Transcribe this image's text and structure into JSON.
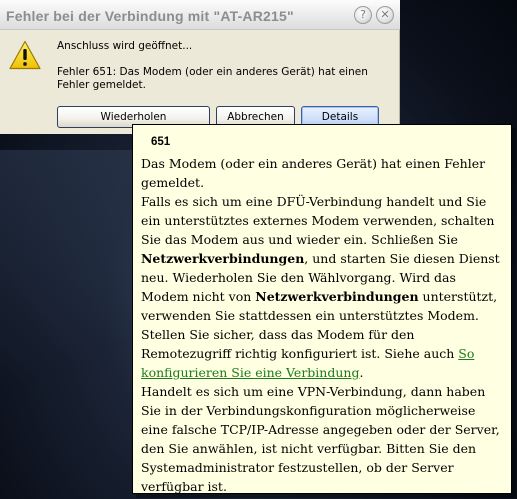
{
  "dialog": {
    "title": "Fehler bei der Verbindung mit \"AT-AR215\"",
    "help_button": "?",
    "close_button": "✕",
    "status": "Anschluss wird geöffnet...",
    "error": "Fehler 651: Das Modem (oder ein anderes Gerät) hat einen Fehler gemeldet.",
    "buttons": {
      "retry": "Wiederholen",
      "cancel": "Abbrechen",
      "details": "Details"
    }
  },
  "help": {
    "code": "651",
    "p1": "Das Modem (oder ein anderes Gerät) hat einen Fehler gemeldet.",
    "p2a": "Falls es sich um eine DFÜ-Verbindung handelt und Sie ein unterstütztes externes Modem verwenden, schalten Sie das Modem aus und wieder ein. Schließen Sie ",
    "p2_bold1": "Netzwerkverbindungen",
    "p2b": ", und starten Sie diesen Dienst neu. Wiederholen Sie den Wählvorgang. Wird das Modem nicht von ",
    "p2_bold2": "Netzwerkverbindungen",
    "p2c": " unterstützt, verwenden Sie stattdessen ein unterstütztes Modem.  Stellen Sie sicher, dass das Modem für den Remotezugriff richtig konfiguriert ist. Siehe auch ",
    "link": "So konfigurieren Sie eine Verbindung",
    "p2d": ".",
    "p3": "Handelt es sich um eine VPN-Verbindung, dann haben Sie in der Verbindungskonfiguration möglicherweise eine falsche TCP/IP-Adresse angegeben oder der Server, den Sie anwählen, ist nicht verfügbar. Bitten Sie den Systemadministrator festzustellen, ob der Server verfügbar ist."
  },
  "icons": {
    "warning": "warning-icon"
  },
  "colors": {
    "dialog_bg": "#ece9d8",
    "popup_bg": "#ffffe1",
    "link": "#1c7a1c",
    "title_text": "#8d8d8d"
  }
}
